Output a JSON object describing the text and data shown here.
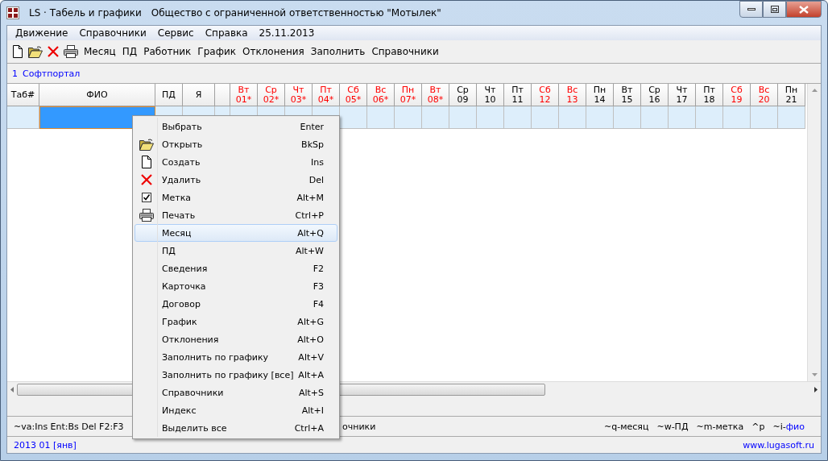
{
  "window": {
    "app_title": "LS · Табель и графики",
    "org_title": "Общество с ограниченной ответственностью \"Мотылек\""
  },
  "menu_bar": {
    "items": [
      "Движение",
      "Справочники",
      "Сервис",
      "Справка"
    ],
    "date": "25.11.2013"
  },
  "toolbar": {
    "icons": [
      {
        "kind": "new"
      },
      {
        "kind": "open"
      },
      {
        "kind": "delete"
      },
      {
        "kind": "print"
      }
    ],
    "buttons": [
      "Месяц",
      "ПД",
      "Работник",
      "График",
      "Отклонения",
      "Заполнить",
      "Справочники"
    ]
  },
  "company": {
    "number": "1",
    "name": "Софтпортал"
  },
  "table": {
    "columns": [
      {
        "label": "Таб#",
        "kind": "tab"
      },
      {
        "label": "ФИО",
        "kind": "name"
      },
      {
        "label": "ПД",
        "kind": "pd"
      },
      {
        "label": "Я",
        "kind": "ya"
      },
      {
        "kind": "blank"
      }
    ],
    "days": [
      {
        "weekday": "Вт",
        "day": "01*",
        "holiday": true
      },
      {
        "weekday": "Ср",
        "day": "02*",
        "holiday": true
      },
      {
        "weekday": "Чт",
        "day": "03*",
        "holiday": true
      },
      {
        "weekday": "Пт",
        "day": "04*",
        "holiday": true
      },
      {
        "weekday": "Сб",
        "day": "05*",
        "holiday": true
      },
      {
        "weekday": "Вс",
        "day": "06*",
        "holiday": true
      },
      {
        "weekday": "Пн",
        "day": "07*",
        "holiday": true
      },
      {
        "weekday": "Вт",
        "day": "08*",
        "holiday": true
      },
      {
        "weekday": "Ср",
        "day": "09",
        "holiday": false
      },
      {
        "weekday": "Чт",
        "day": "10",
        "holiday": false
      },
      {
        "weekday": "Пт",
        "day": "11",
        "holiday": false
      },
      {
        "weekday": "Сб",
        "day": "12",
        "holiday": true
      },
      {
        "weekday": "Вс",
        "day": "13",
        "holiday": true
      },
      {
        "weekday": "Пн",
        "day": "14",
        "holiday": false
      },
      {
        "weekday": "Вт",
        "day": "15",
        "holiday": false
      },
      {
        "weekday": "Ср",
        "day": "16",
        "holiday": false
      },
      {
        "weekday": "Чт",
        "day": "17",
        "holiday": false
      },
      {
        "weekday": "Пт",
        "day": "18",
        "holiday": false
      },
      {
        "weekday": "Сб",
        "day": "19",
        "holiday": true
      },
      {
        "weekday": "Вс",
        "day": "20",
        "holiday": true
      },
      {
        "weekday": "Пн",
        "day": "21",
        "holiday": false
      }
    ],
    "rows": [
      {
        "selected": true
      }
    ]
  },
  "context_menu": {
    "items": [
      {
        "kind": "plain",
        "label": "Выбрать",
        "shortcut": "Enter",
        "selected": false
      },
      {
        "kind": "open",
        "label": "Открыть",
        "shortcut": "BkSp",
        "selected": false
      },
      {
        "kind": "new",
        "label": "Создать",
        "shortcut": "Ins",
        "selected": false
      },
      {
        "kind": "delete",
        "label": "Удалить",
        "shortcut": "Del",
        "selected": false
      },
      {
        "kind": "mark",
        "label": "Метка",
        "shortcut": "Alt+M",
        "selected": false
      },
      {
        "kind": "print",
        "label": "Печать",
        "shortcut": "Ctrl+P",
        "selected": false
      },
      {
        "kind": "plain",
        "label": "Месяц",
        "shortcut": "Alt+Q",
        "selected": true
      },
      {
        "kind": "plain",
        "label": "ПД",
        "shortcut": "Alt+W",
        "selected": false
      },
      {
        "kind": "plain",
        "label": "Сведения",
        "shortcut": "F2",
        "selected": false
      },
      {
        "kind": "plain",
        "label": "Карточка",
        "shortcut": "F3",
        "selected": false
      },
      {
        "kind": "plain",
        "label": "Договор",
        "shortcut": "F4",
        "selected": false
      },
      {
        "kind": "plain",
        "label": "График",
        "shortcut": "Alt+G",
        "selected": false
      },
      {
        "kind": "plain",
        "label": "Отклонения",
        "shortcut": "Alt+O",
        "selected": false
      },
      {
        "kind": "plain",
        "label": "Заполнить по графику",
        "shortcut": "Alt+V",
        "selected": false
      },
      {
        "kind": "plain",
        "label": "Заполнить по графику [все]",
        "shortcut": "Alt+A",
        "selected": false
      },
      {
        "kind": "plain",
        "label": "Справочники",
        "shortcut": "Alt+S",
        "selected": false
      },
      {
        "kind": "plain",
        "label": "Индекс",
        "shortcut": "Alt+I",
        "selected": false
      },
      {
        "kind": "plain",
        "label": "Выделить все",
        "shortcut": "Ctrl+A",
        "selected": false
      }
    ]
  },
  "hint_bar": {
    "left": "~va:Ins Ent:Bs Del  F2:F3",
    "left_tail": "очники",
    "right": [
      {
        "text": "~q-месяц"
      },
      {
        "text": "~w-ПД"
      },
      {
        "text": "~m-метка"
      },
      {
        "text": "^p"
      },
      {
        "text": "~i-",
        "link": "фио"
      }
    ]
  },
  "status_bar": {
    "period": "2013 01 [янв]",
    "website": "www.lugasoft.ru"
  }
}
